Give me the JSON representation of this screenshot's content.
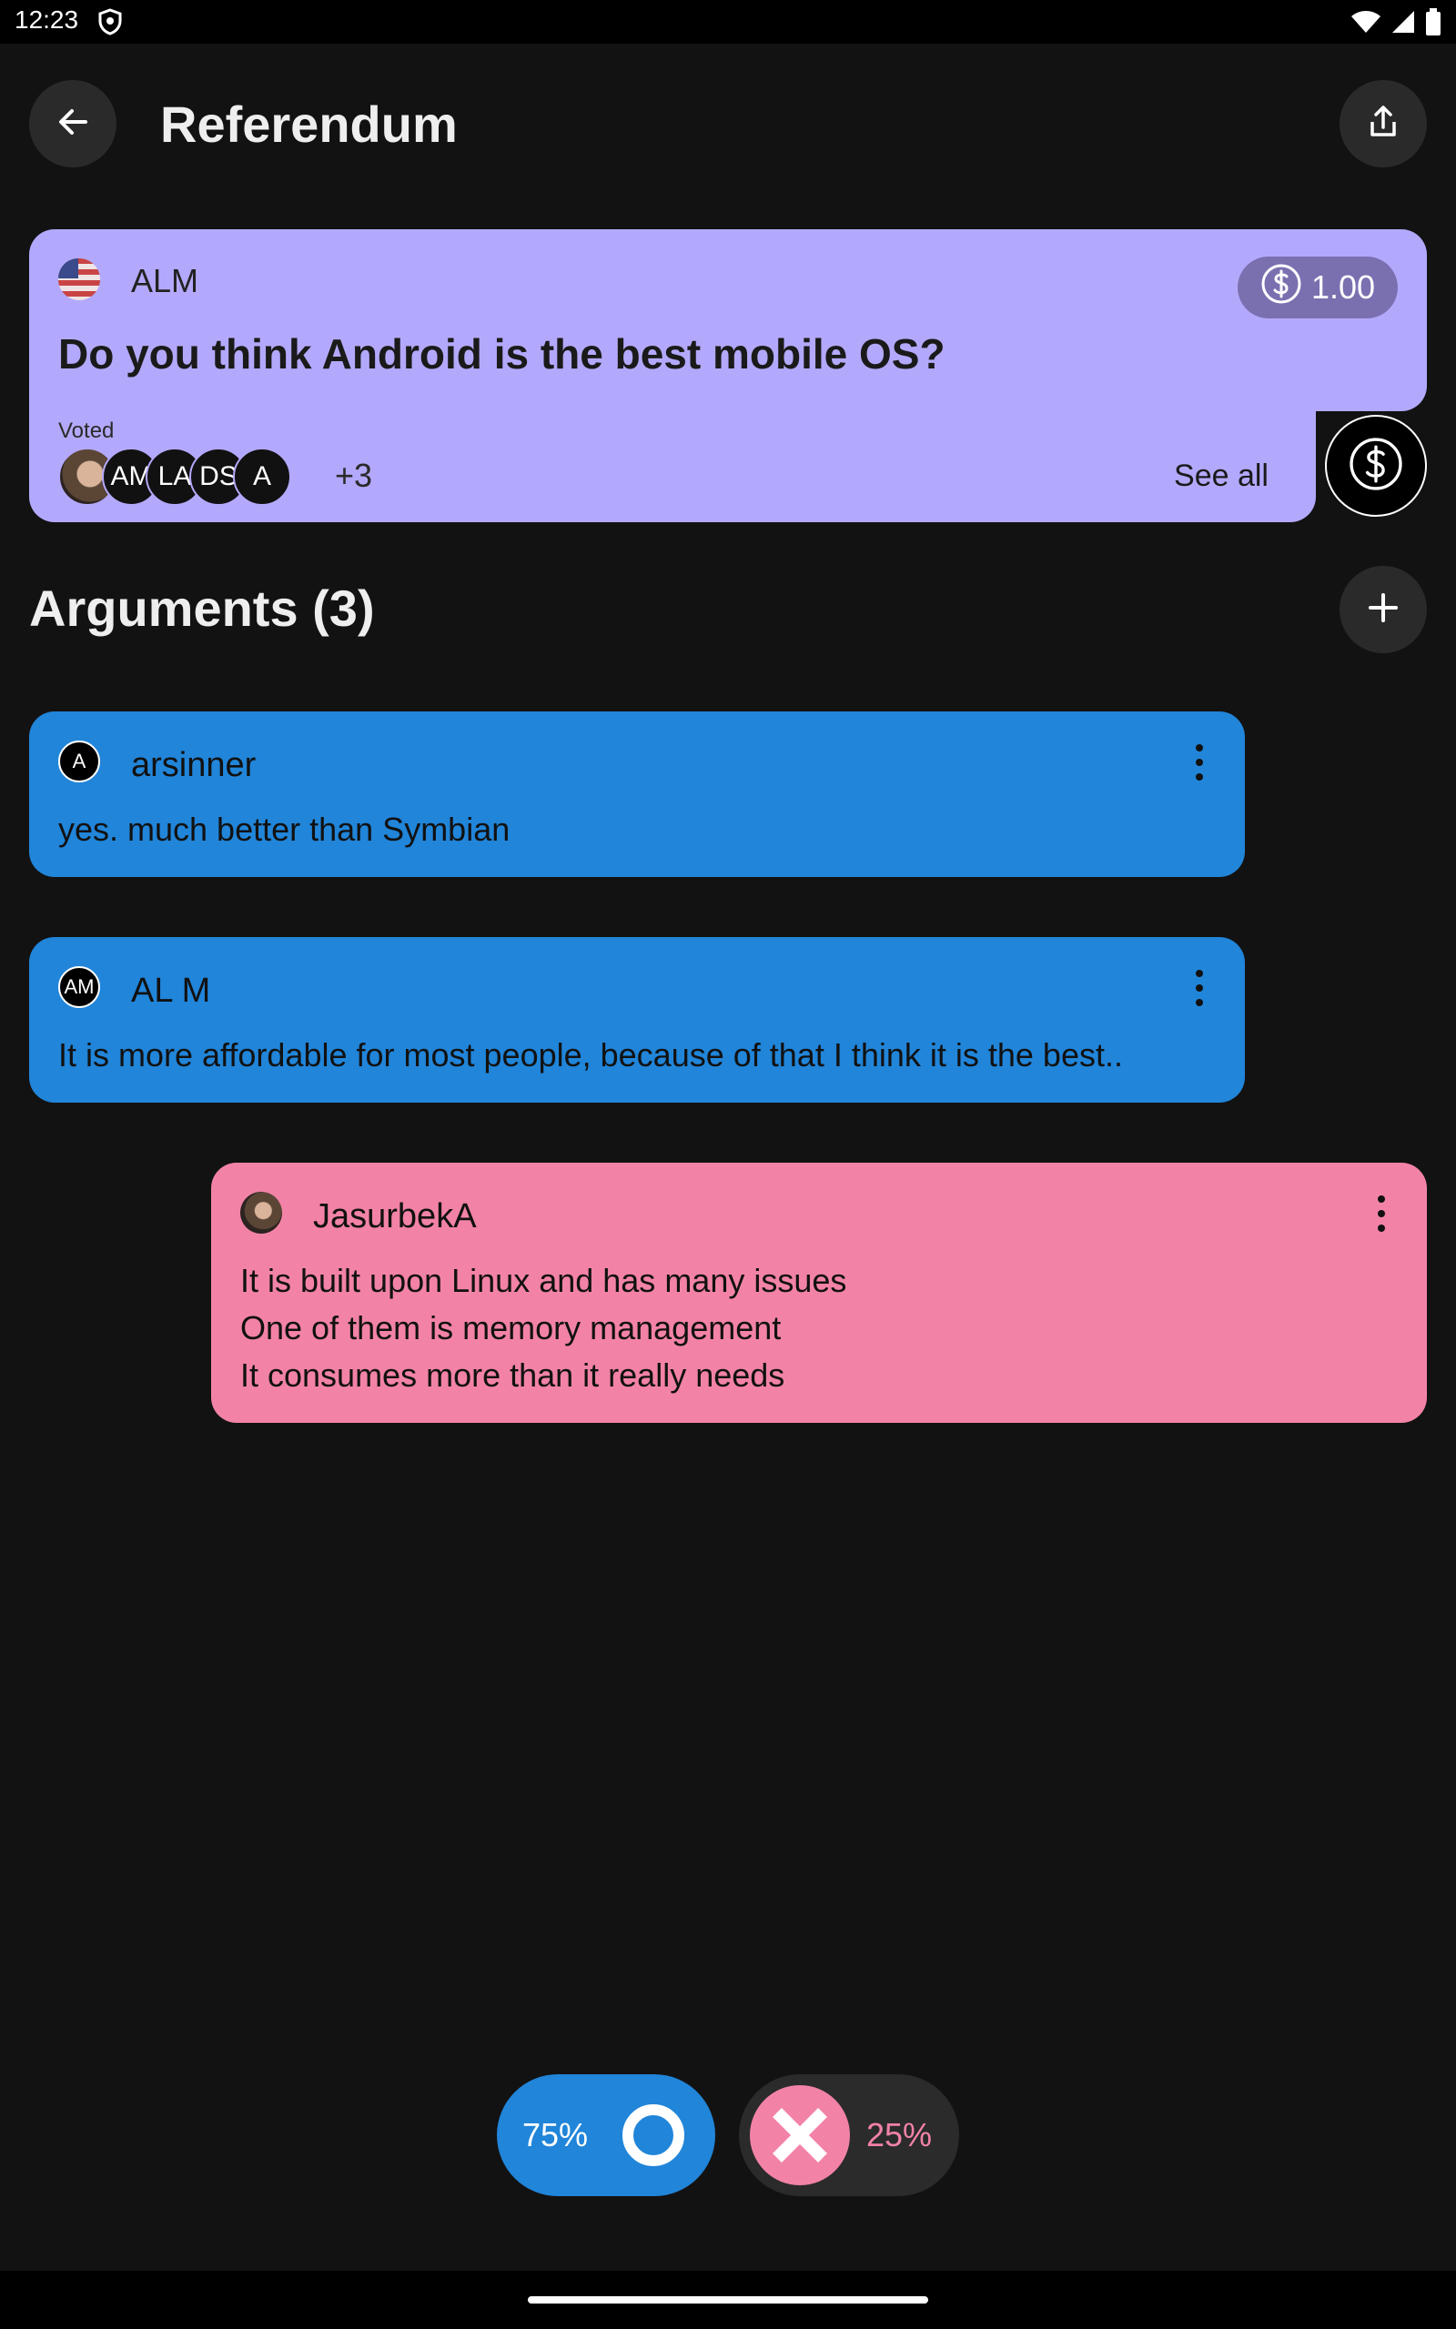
{
  "status_bar": {
    "time": "12:23"
  },
  "header": {
    "title": "Referendum"
  },
  "question": {
    "author": "ALM",
    "reward": "1.00",
    "text": "Do you think Android is the best mobile OS?",
    "voted_label": "Voted",
    "voters": [
      "AM",
      "LA",
      "DS",
      "A"
    ],
    "voters_more": "+3",
    "see_all": "See all"
  },
  "arguments": {
    "title": "Arguments (3)",
    "items": [
      {
        "avatar": "A",
        "author": "arsinner",
        "text": "yes. much better than Symbian",
        "side": "yes"
      },
      {
        "avatar": "AM",
        "author": "AL M",
        "text": "It is more affordable for most people, because of that I think it is the best..",
        "side": "yes"
      },
      {
        "avatar": "",
        "author": "JasurbekA",
        "text": "It is built upon Linux and has many issues\nOne of them is memory management\nIt consumes more than it really needs",
        "side": "no"
      }
    ]
  },
  "vote": {
    "yes_pct": "75%",
    "no_pct": "25%"
  },
  "colors": {
    "question_card": "#b3a9fc",
    "yes": "#2185d9",
    "no": "#f283a6",
    "background": "#121212"
  }
}
